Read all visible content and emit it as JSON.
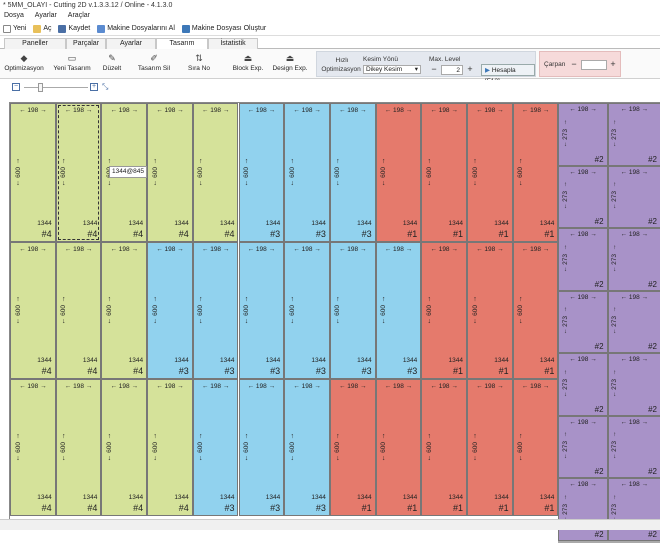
{
  "window": {
    "title": "* 5MM_OLAYI - Cutting 2D v.1.3.3.12 / Online - 4.1.3.0"
  },
  "menu": {
    "items": [
      "Dosya",
      "Ayarlar",
      "Araçlar"
    ]
  },
  "quickbar": {
    "new": "Yeni",
    "open": "Aç",
    "save": "Kaydet",
    "machine_files": "Makine Dosyalarını Al",
    "create_machine_file": "Makine Dosyası Oluştur"
  },
  "tabs": [
    "Paneller",
    "Parçalar",
    "Ayarlar",
    "Tasarım",
    "İstatistik"
  ],
  "ribbon": {
    "optimize": "Optimizasyon",
    "new_design": "Yeni Tasarım",
    "edit": "Düzelt",
    "delete_design": "Tasarım Sil",
    "order_no": "Sıra No",
    "block_exp": "Block Exp.",
    "design_exp": "Design Exp.",
    "quick_opt_line1": "Hızlı",
    "quick_opt_line2": "Optimizasyon",
    "cut_dir_label": "Kesim Yönü",
    "cut_dir_value": "Dikey Kesim",
    "max_level_label": "Max. Level",
    "max_level_value": "2",
    "calculate": "Hesapla [F12]",
    "multiplier_label": "Çarpan",
    "multiplier_value": ""
  },
  "colors": {
    "green": "#d5e29a",
    "blue": "#91d2ee",
    "red": "#e57a6c",
    "purple": "#a892c8"
  },
  "piece_width": "198",
  "piece_height": "600",
  "piece_size": "1344",
  "small_height": "273",
  "tooltip": "1344@845",
  "waste_label": "198 x 160.6",
  "rows": [
    {
      "labels": [
        "#4",
        "#4",
        "#4",
        "#4",
        "#4",
        "#3",
        "#3",
        "#3",
        "#1",
        "#1",
        "#1",
        "#1"
      ],
      "colors": [
        "g",
        "g",
        "g",
        "g",
        "g",
        "b",
        "b",
        "b",
        "r",
        "r",
        "r",
        "r"
      ]
    },
    {
      "labels": [
        "#4",
        "#4",
        "#4",
        "#3",
        "#3",
        "#3",
        "#3",
        "#3",
        "#3",
        "#1",
        "#1",
        "#1"
      ],
      "colors": [
        "g",
        "g",
        "g",
        "b",
        "b",
        "b",
        "b",
        "b",
        "b",
        "r",
        "r",
        "r"
      ]
    },
    {
      "labels": [
        "#4",
        "#4",
        "#4",
        "#4",
        "#3",
        "#3",
        "#3",
        "#1",
        "#1",
        "#1",
        "#1",
        "#1"
      ],
      "colors": [
        "g",
        "g",
        "g",
        "g",
        "b",
        "b",
        "b",
        "r",
        "r",
        "r",
        "r",
        "r"
      ]
    }
  ],
  "small_labels": [
    "#2",
    "#2",
    "#2",
    "#2",
    "#2",
    "#2",
    "#2",
    "#2",
    "#2",
    "#2",
    "#2",
    "#2",
    "#2",
    "#2"
  ]
}
